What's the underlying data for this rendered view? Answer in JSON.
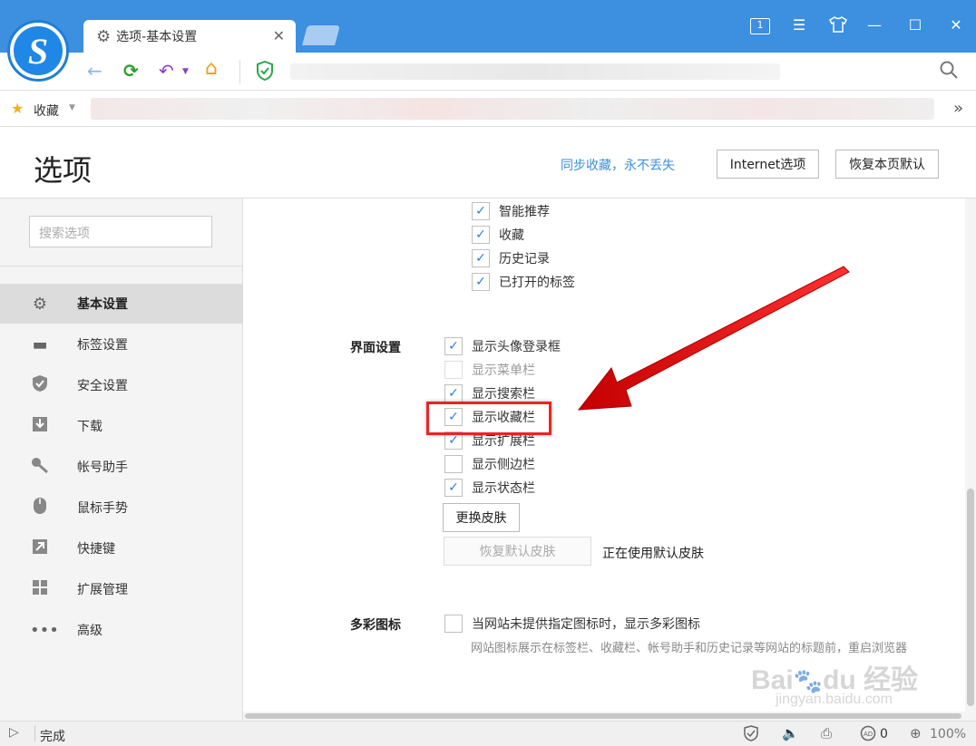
{
  "tab": {
    "title": "选项-基本设置",
    "close": "✕"
  },
  "window_controls": {
    "tab_count": "1",
    "menu": "☰",
    "skin": "👕",
    "minimize": "—",
    "maximize": "☐",
    "close": "✕"
  },
  "toolbar": {
    "back": "←",
    "refresh": "⟳",
    "undo": "↶",
    "home": "⌂",
    "shield": "✓"
  },
  "bookmarks_bar": {
    "label": "收藏",
    "more": "»"
  },
  "header": {
    "title": "选项",
    "sync_link": "同步收藏，永不丢失",
    "internet_options": "Internet选项",
    "restore_defaults": "恢复本页默认"
  },
  "sidebar": {
    "search_placeholder": "搜索选项",
    "items": [
      {
        "label": "基本设置",
        "icon": "gear-icon",
        "active": true
      },
      {
        "label": "标签设置",
        "icon": "tab-icon",
        "active": false
      },
      {
        "label": "安全设置",
        "icon": "shield-icon",
        "active": false
      },
      {
        "label": "下载",
        "icon": "download-icon",
        "active": false
      },
      {
        "label": "帐号助手",
        "icon": "key-icon",
        "active": false
      },
      {
        "label": "鼠标手势",
        "icon": "mouse-icon",
        "active": false
      },
      {
        "label": "快捷键",
        "icon": "shortcut-icon",
        "active": false
      },
      {
        "label": "扩展管理",
        "icon": "extensions-icon",
        "active": false
      },
      {
        "label": "高级",
        "icon": "more-icon",
        "active": false
      }
    ]
  },
  "new_tab_items": [
    {
      "label": "智能推荐",
      "checked": true
    },
    {
      "label": "收藏",
      "checked": true
    },
    {
      "label": "历史记录",
      "checked": true
    },
    {
      "label": "已打开的标签",
      "checked": true
    }
  ],
  "ui_settings": {
    "title": "界面设置",
    "options": [
      {
        "label": "显示头像登录框",
        "checked": true,
        "disabled": false
      },
      {
        "label": "显示菜单栏",
        "checked": false,
        "disabled": true
      },
      {
        "label": "显示搜索栏",
        "checked": true,
        "disabled": false
      },
      {
        "label": "显示收藏栏",
        "checked": true,
        "disabled": false
      },
      {
        "label": "显示扩展栏",
        "checked": true,
        "disabled": false
      },
      {
        "label": "显示侧边栏",
        "checked": false,
        "disabled": false
      },
      {
        "label": "显示状态栏",
        "checked": true,
        "disabled": false
      }
    ],
    "change_skin": "更换皮肤",
    "restore_skin": "恢复默认皮肤",
    "skin_status": "正在使用默认皮肤"
  },
  "favicon_settings": {
    "title": "多彩图标",
    "option": "当网站未提供指定图标时，显示多彩图标",
    "description": "网站图标展示在标签栏、收藏栏、帐号助手和历史记录等网站的标题前，重启浏览器"
  },
  "statusbar": {
    "text": "完成",
    "ad_count": "0",
    "zoom": "100%"
  },
  "watermark": {
    "text": "Bai du 经验",
    "sub": "jingyan.baidu.com"
  },
  "colors": {
    "titlebar": "#3d8fe0",
    "accent": "#2f7ed8",
    "highlight": "#e22222",
    "link": "#3b8fdd"
  }
}
